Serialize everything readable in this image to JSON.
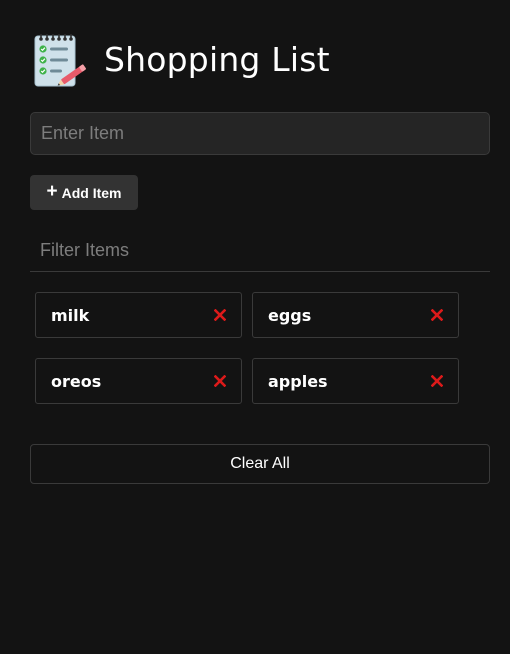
{
  "header": {
    "logo_icon": "notepad-checklist-icon",
    "title": "Shopping List"
  },
  "form": {
    "item_placeholder": "Enter Item",
    "item_value": "",
    "add_button_icon": "plus-icon",
    "add_button_label": "Add Item"
  },
  "filter": {
    "placeholder": "Filter Items",
    "value": ""
  },
  "items": [
    {
      "name": "milk",
      "remove_icon": "close-icon"
    },
    {
      "name": "eggs",
      "remove_icon": "close-icon"
    },
    {
      "name": "oreos",
      "remove_icon": "close-icon"
    },
    {
      "name": "apples",
      "remove_icon": "close-icon"
    }
  ],
  "clear_button_label": "Clear All",
  "colors": {
    "background": "#131313",
    "remove_icon": "#dc1a1a",
    "border": "#3a3a3a"
  }
}
